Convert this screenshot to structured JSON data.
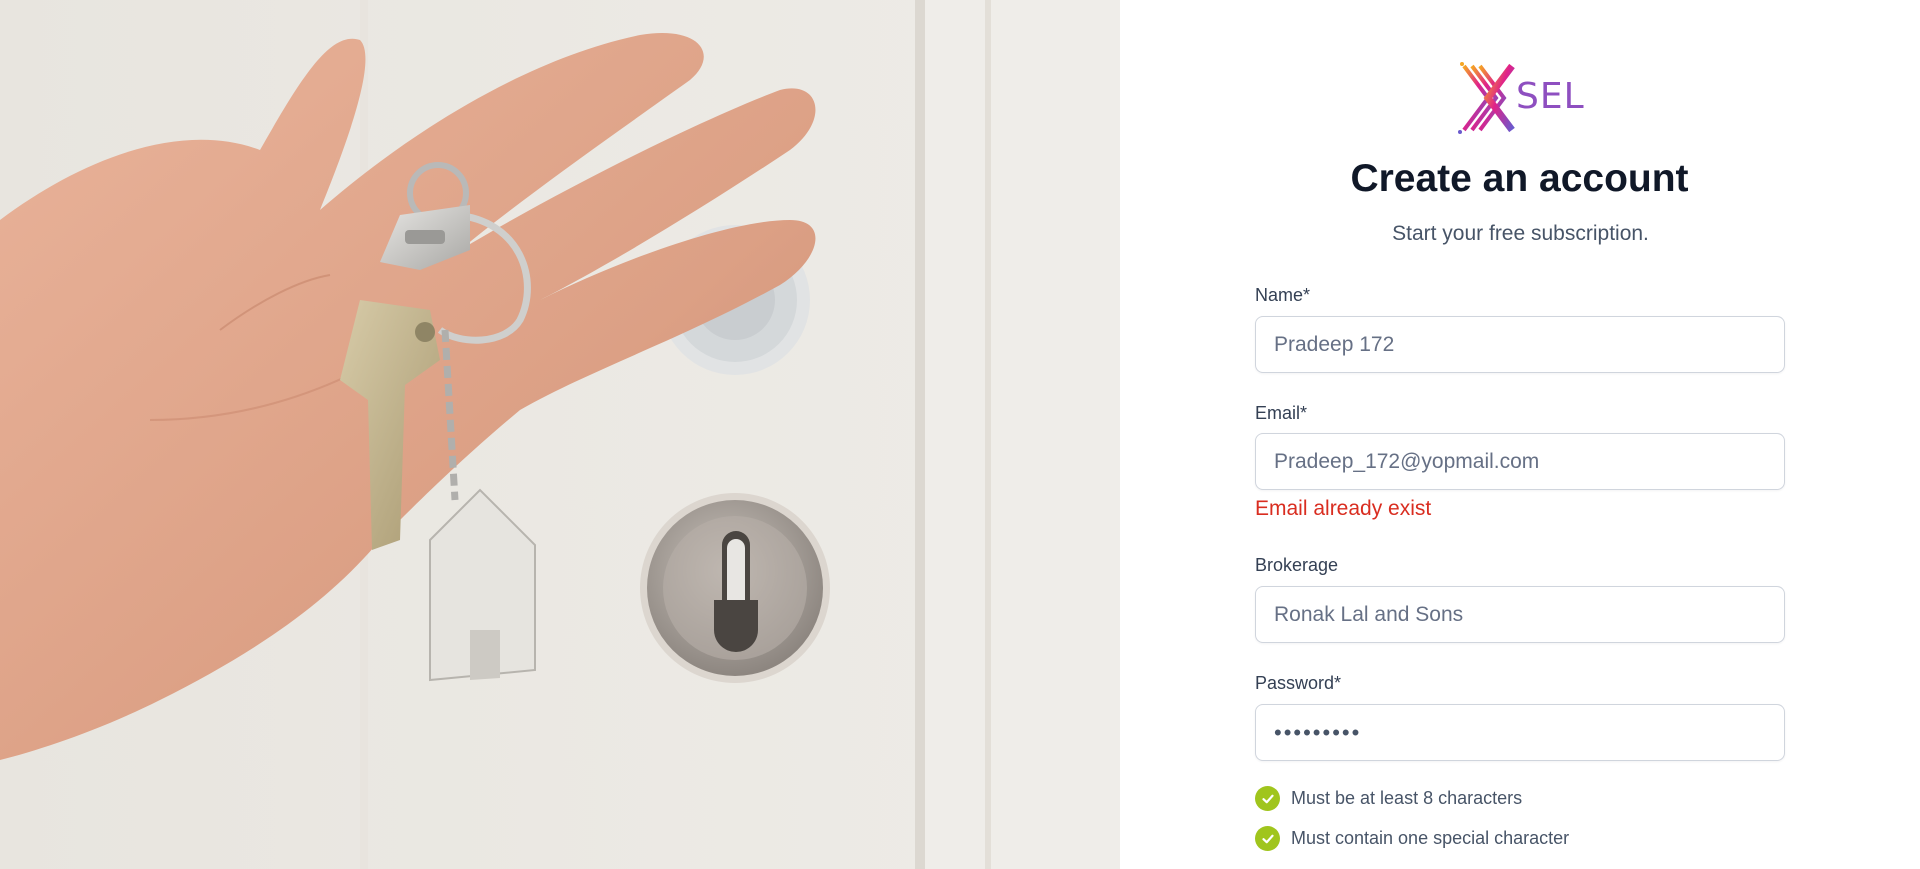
{
  "brand": {
    "logo_text": "SEL",
    "logo_mark": "x-logo-mark",
    "accent_colors": [
      "#e0218a",
      "#8e4fc0",
      "#f5a623"
    ]
  },
  "form": {
    "title": "Create an account",
    "subtitle": "Start your free subscription.",
    "name": {
      "label": "Name*",
      "value": "Pradeep 172"
    },
    "email": {
      "label": "Email*",
      "value": "Pradeep_172@yopmail.com",
      "error": "Email already exist",
      "error_color": "#d92d20"
    },
    "brokerage": {
      "label": "Brokerage",
      "value": "Ronak Lal and Sons"
    },
    "password": {
      "label": "Password*",
      "value": "•••••••••"
    },
    "rules": [
      {
        "text": "Must be at least 8 characters",
        "met": true,
        "icon": "check-circle-icon"
      },
      {
        "text": "Must contain one special character",
        "met": true,
        "icon": "check-circle-icon"
      }
    ],
    "rule_met_color": "#a0c51d"
  }
}
